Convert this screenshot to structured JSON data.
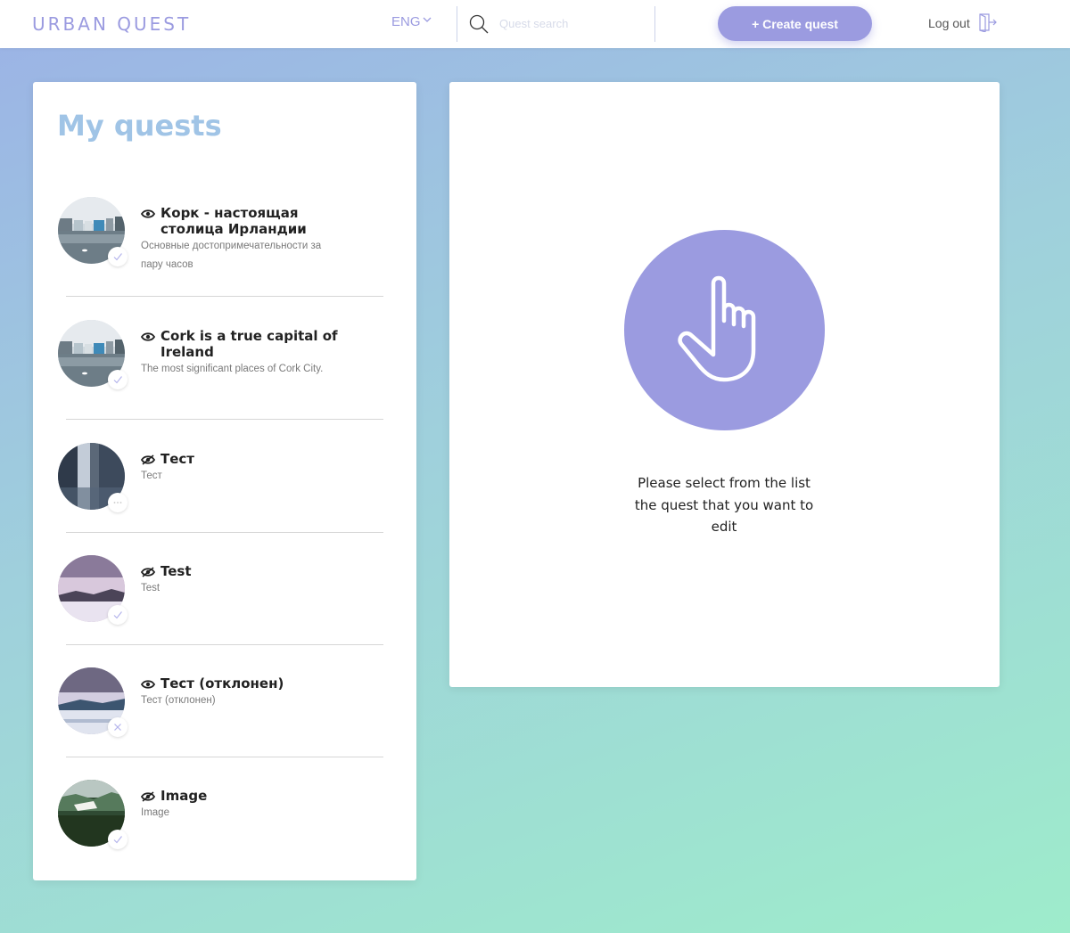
{
  "header": {
    "logo": "URBAN QUEST",
    "language": "ENG",
    "search_placeholder": "Quest search",
    "create_label": "+ Create quest",
    "logout_label": "Log out"
  },
  "quests": {
    "title": "My quests",
    "items": [
      {
        "title": "Корк - настоящая столица Ирландии",
        "subtitle": "Основные достопримечательности за пару часов",
        "visibility": "visible",
        "status": "approved"
      },
      {
        "title": "Cork is a true capital of Ireland",
        "subtitle": "The most significant places of Cork City.",
        "visibility": "visible",
        "status": "approved"
      },
      {
        "title": "Тест",
        "subtitle": "Тест",
        "visibility": "hidden",
        "status": "pending"
      },
      {
        "title": "Test",
        "subtitle": "Test",
        "visibility": "hidden",
        "status": "approved"
      },
      {
        "title": "Тест (отклонен)",
        "subtitle": "Тест (отклонен)",
        "visibility": "visible",
        "status": "rejected"
      },
      {
        "title": "Image",
        "subtitle": "Image",
        "visibility": "hidden",
        "status": "approved"
      }
    ]
  },
  "editor": {
    "message": "Please select from the list the quest that you want to edit"
  },
  "colors": {
    "accent": "#9b9be0",
    "title": "#a0c4e6"
  }
}
